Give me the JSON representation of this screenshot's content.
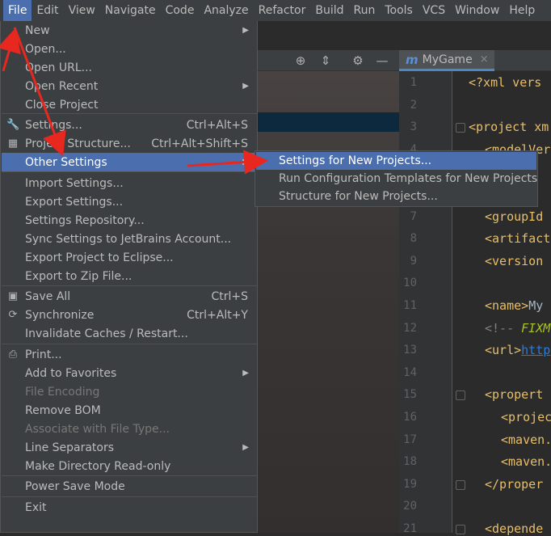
{
  "menubar": [
    "File",
    "Edit",
    "View",
    "Navigate",
    "Code",
    "Analyze",
    "Refactor",
    "Build",
    "Run",
    "Tools",
    "VCS",
    "Window",
    "Help"
  ],
  "toolbar": {
    "icons": [
      "crosshair-icon",
      "collapse-icon",
      "gear-icon",
      "minimize-icon"
    ]
  },
  "editor_tab": {
    "icon": "m",
    "title": "MyGame",
    "close": "×"
  },
  "line_numbers": [
    "1",
    "2",
    "3",
    "4",
    "5",
    "6",
    "7",
    "8",
    "9",
    "10",
    "11",
    "12",
    "13",
    "14",
    "15",
    "16",
    "17",
    "18",
    "19",
    "20",
    "21"
  ],
  "code": {
    "l1": "<?xml vers",
    "l3": "<project xm",
    "l4": "<modelVer",
    "l7_tag": "<groupId",
    "l8_tag": "<artifact",
    "l9_tag": "<version",
    "l11_tag": "<name>",
    "l11_text": "My",
    "l12_comment": "<!-- ",
    "l12_fixme": "FIXM",
    "l13_tag": "<url>",
    "l13_link": "http",
    "l15_tag": "<propert",
    "l16_tag": "<projec",
    "l17_tag": "<maven.",
    "l18_tag": "<maven.",
    "l19_tag": "</proper",
    "l21_tag": "<depende"
  },
  "file_menu": {
    "items": [
      {
        "label": "New",
        "shortcut": "",
        "submenu": true,
        "icon": ""
      },
      {
        "label": "Open...",
        "shortcut": "",
        "submenu": false,
        "icon": "folder-icon"
      },
      {
        "label": "Open URL...",
        "shortcut": "",
        "submenu": false,
        "icon": ""
      },
      {
        "label": "Open Recent",
        "shortcut": "",
        "submenu": true,
        "icon": ""
      },
      {
        "label": "Close Project",
        "shortcut": "",
        "submenu": false,
        "icon": ""
      },
      {
        "label": "Settings...",
        "shortcut": "Ctrl+Alt+S",
        "submenu": false,
        "icon": "wrench-icon"
      },
      {
        "label": "Project Structure...",
        "shortcut": "Ctrl+Alt+Shift+S",
        "submenu": false,
        "icon": "project-structure-icon"
      },
      {
        "label": "Other Settings",
        "shortcut": "",
        "submenu": true,
        "icon": "",
        "highlighted": true
      },
      {
        "label": "Import Settings...",
        "shortcut": "",
        "submenu": false,
        "icon": ""
      },
      {
        "label": "Export Settings...",
        "shortcut": "",
        "submenu": false,
        "icon": ""
      },
      {
        "label": "Settings Repository...",
        "shortcut": "",
        "submenu": false,
        "icon": ""
      },
      {
        "label": "Sync Settings to JetBrains Account...",
        "shortcut": "",
        "submenu": false,
        "icon": ""
      },
      {
        "label": "Export Project to Eclipse...",
        "shortcut": "",
        "submenu": false,
        "icon": ""
      },
      {
        "label": "Export to Zip File...",
        "shortcut": "",
        "submenu": false,
        "icon": ""
      },
      {
        "label": "Save All",
        "shortcut": "Ctrl+S",
        "submenu": false,
        "icon": "save-icon"
      },
      {
        "label": "Synchronize",
        "shortcut": "Ctrl+Alt+Y",
        "submenu": false,
        "icon": "sync-icon"
      },
      {
        "label": "Invalidate Caches / Restart...",
        "shortcut": "",
        "submenu": false,
        "icon": ""
      },
      {
        "label": "Print...",
        "shortcut": "",
        "submenu": false,
        "icon": "print-icon"
      },
      {
        "label": "Add to Favorites",
        "shortcut": "",
        "submenu": true,
        "icon": ""
      },
      {
        "label": "File Encoding",
        "shortcut": "",
        "submenu": false,
        "icon": "",
        "disabled": true
      },
      {
        "label": "Remove BOM",
        "shortcut": "",
        "submenu": false,
        "icon": ""
      },
      {
        "label": "Associate with File Type...",
        "shortcut": "",
        "submenu": false,
        "icon": "",
        "disabled": true
      },
      {
        "label": "Line Separators",
        "shortcut": "",
        "submenu": true,
        "icon": ""
      },
      {
        "label": "Make Directory Read-only",
        "shortcut": "",
        "submenu": false,
        "icon": ""
      },
      {
        "label": "Power Save Mode",
        "shortcut": "",
        "submenu": false,
        "icon": ""
      },
      {
        "label": "Exit",
        "shortcut": "",
        "submenu": false,
        "icon": ""
      }
    ]
  },
  "other_settings_submenu": [
    {
      "label": "Settings for New Projects...",
      "highlighted": true
    },
    {
      "label": "Run Configuration Templates for New Projects",
      "highlighted": false
    },
    {
      "label": "Structure for New Projects...",
      "highlighted": false
    }
  ],
  "colors": {
    "menu_bg": "#3c3f41",
    "highlight": "#4b6eaf",
    "annotation_arrow": "#e8281e",
    "editor_bg": "#2b2b2b",
    "tag": "#e8bf6a"
  }
}
